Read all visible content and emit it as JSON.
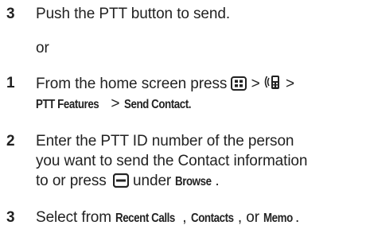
{
  "steps": [
    {
      "number": "3",
      "line1": "Push the PTT button to send."
    },
    {
      "or_text": "or"
    },
    {
      "number": "1",
      "line1_prefix": "From the home screen press",
      "sep1": " > ",
      "sep2": " >",
      "line2_a": "PTT Features",
      "line2_sep": " > ",
      "line2_b": "Send Contact."
    },
    {
      "number": "2",
      "line1": "Enter the PTT ID number of the person",
      "line2": "you want to send the Contact information",
      "line3_prefix": "to or press",
      "line3_mid": " under ",
      "line3_kw": "Browse",
      "line3_end": "."
    },
    {
      "number": "3",
      "prefix": "Select from ",
      "kw1": "Recent Calls",
      "sep1": ", ",
      "kw2": "Contacts",
      "sep2": ", or ",
      "kw3": "Memo",
      "end": "."
    }
  ],
  "icons": {
    "menu_key": "menu-key-icon",
    "ptt_phone": "ptt-phone-icon",
    "softkey": "softkey-icon"
  }
}
